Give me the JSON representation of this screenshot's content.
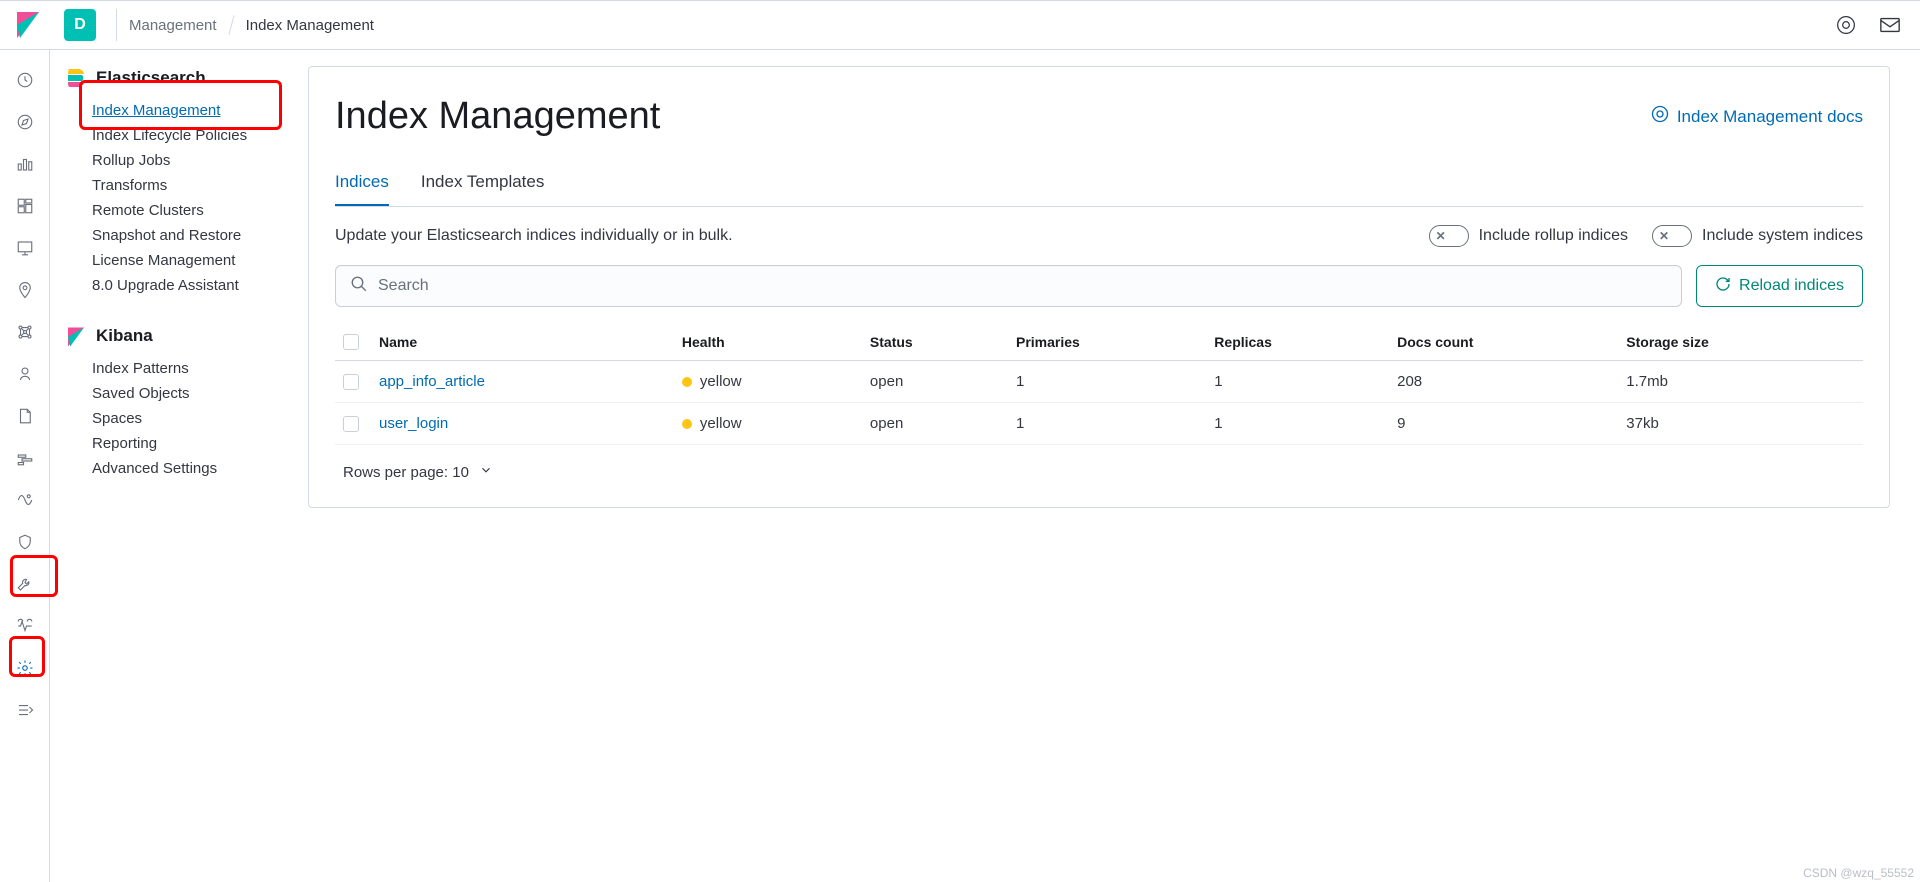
{
  "header": {
    "space_letter": "D",
    "breadcrumbs": {
      "parent": "Management",
      "current": "Index Management"
    }
  },
  "sidebar": {
    "sections": [
      {
        "title": "Elasticsearch",
        "icon": "elasticsearch",
        "items": [
          {
            "label": "Index Management",
            "selected": true
          },
          {
            "label": "Index Lifecycle Policies"
          },
          {
            "label": "Rollup Jobs"
          },
          {
            "label": "Transforms"
          },
          {
            "label": "Remote Clusters"
          },
          {
            "label": "Snapshot and Restore"
          },
          {
            "label": "License Management"
          },
          {
            "label": "8.0 Upgrade Assistant"
          }
        ]
      },
      {
        "title": "Kibana",
        "icon": "kibana",
        "items": [
          {
            "label": "Index Patterns"
          },
          {
            "label": "Saved Objects"
          },
          {
            "label": "Spaces"
          },
          {
            "label": "Reporting"
          },
          {
            "label": "Advanced Settings"
          }
        ]
      }
    ]
  },
  "page": {
    "title": "Index Management",
    "docs_link": "Index Management docs",
    "tabs": [
      {
        "label": "Indices",
        "active": true
      },
      {
        "label": "Index Templates"
      }
    ],
    "description": "Update your Elasticsearch indices individually or in bulk.",
    "toggles": {
      "rollup": "Include rollup indices",
      "system": "Include system indices"
    },
    "search_placeholder": "Search",
    "reload_label": "Reload indices",
    "columns": [
      "Name",
      "Health",
      "Status",
      "Primaries",
      "Replicas",
      "Docs count",
      "Storage size"
    ],
    "rows": [
      {
        "name": "app_info_article",
        "health": "yellow",
        "status": "open",
        "primaries": "1",
        "replicas": "1",
        "docs": "208",
        "storage": "1.7mb"
      },
      {
        "name": "user_login",
        "health": "yellow",
        "status": "open",
        "primaries": "1",
        "replicas": "1",
        "docs": "9",
        "storage": "37kb"
      }
    ],
    "pager": "Rows per page: 10"
  },
  "watermark": "CSDN @wzq_55552"
}
